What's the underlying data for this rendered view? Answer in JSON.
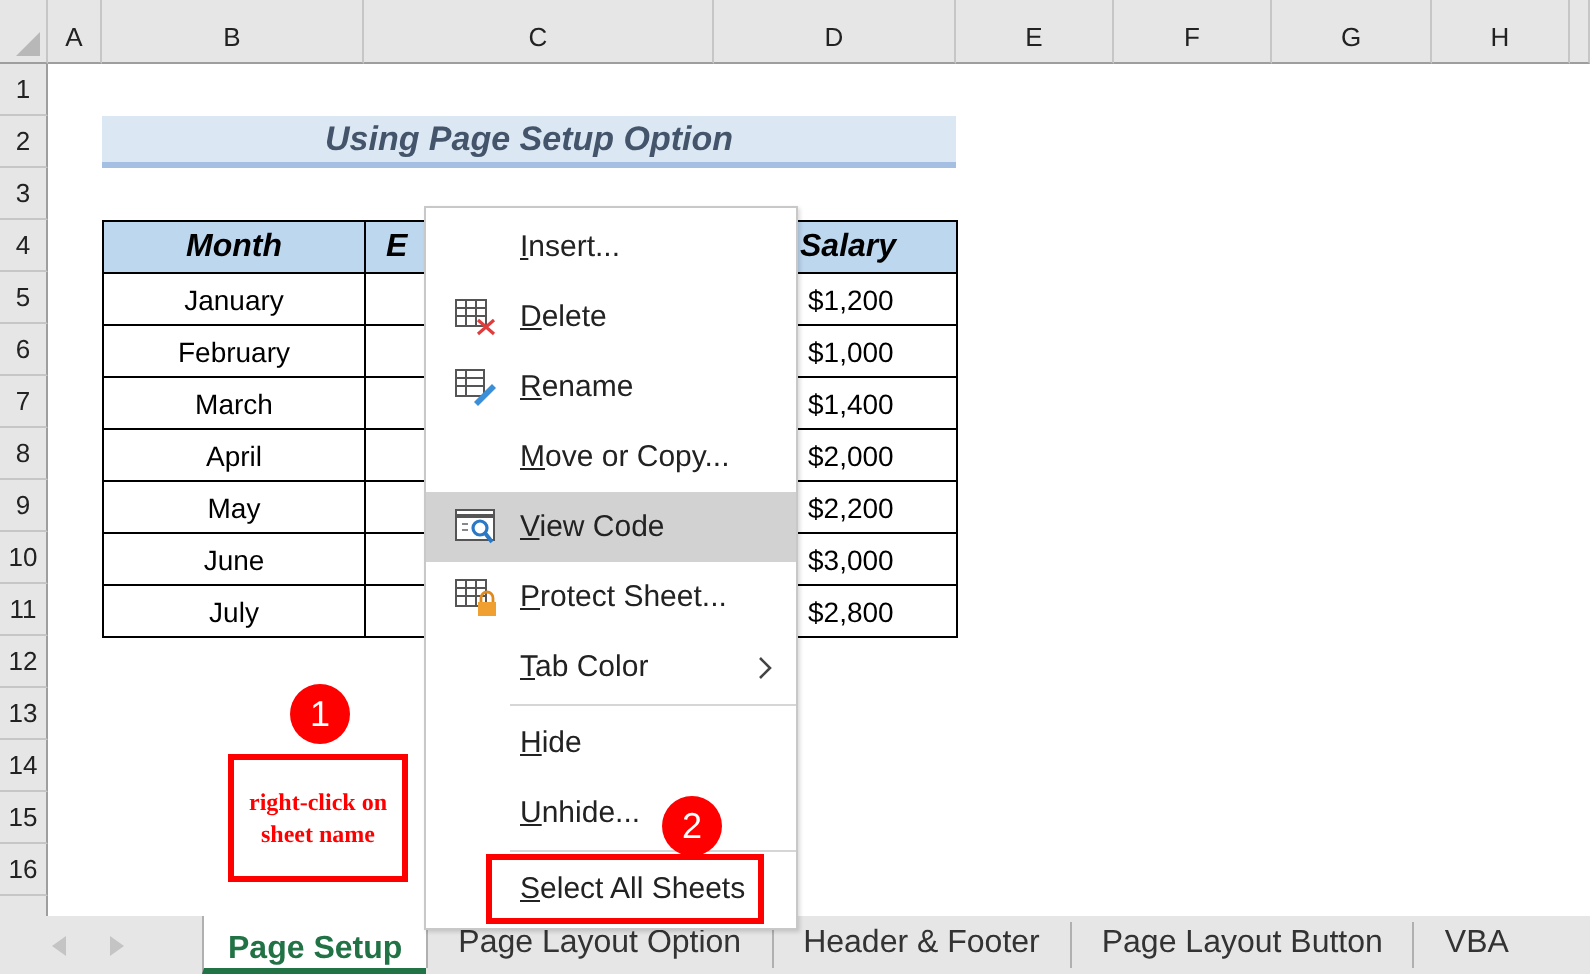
{
  "column_headers": [
    "A",
    "B",
    "C",
    "D",
    "E",
    "F",
    "G",
    "H"
  ],
  "row_headers": [
    "1",
    "2",
    "3",
    "4",
    "5",
    "6",
    "7",
    "8",
    "9",
    "10",
    "11",
    "12",
    "13",
    "14",
    "15",
    "16"
  ],
  "title": "Using Page Setup Option",
  "table": {
    "columns": [
      "Month",
      "E",
      "Salary"
    ],
    "rows": [
      {
        "month": "January",
        "salary": "$1,200"
      },
      {
        "month": "February",
        "salary": "$1,000"
      },
      {
        "month": "March",
        "salary": "$1,400"
      },
      {
        "month": "April",
        "salary": "$2,000"
      },
      {
        "month": "May",
        "salary": "$2,200"
      },
      {
        "month": "June",
        "salary": "$3,000"
      },
      {
        "month": "July",
        "salary": "$2,800"
      }
    ]
  },
  "context_menu": [
    {
      "label": "Insert...",
      "kind": "plain",
      "highlighted": false,
      "separator_before": false,
      "annotated": false
    },
    {
      "label": "Delete",
      "kind": "delete",
      "highlighted": false,
      "separator_before": false,
      "annotated": false
    },
    {
      "label": "Rename",
      "kind": "rename",
      "highlighted": false,
      "separator_before": false,
      "annotated": false
    },
    {
      "label": "Move or Copy...",
      "kind": "plain",
      "highlighted": false,
      "separator_before": false,
      "annotated": false
    },
    {
      "label": "View Code",
      "kind": "code",
      "highlighted": true,
      "separator_before": false,
      "annotated": false
    },
    {
      "label": "Protect Sheet...",
      "kind": "protect",
      "highlighted": false,
      "separator_before": false,
      "annotated": false
    },
    {
      "label": "Tab Color",
      "kind": "submenu",
      "highlighted": false,
      "separator_before": false,
      "annotated": false
    },
    {
      "label": "Hide",
      "kind": "plain",
      "highlighted": false,
      "separator_before": true,
      "annotated": false
    },
    {
      "label": "Unhide...",
      "kind": "plain",
      "highlighted": false,
      "separator_before": false,
      "annotated": false
    },
    {
      "label": "Select All Sheets",
      "kind": "plain",
      "highlighted": false,
      "separator_before": true,
      "annotated": true
    }
  ],
  "annotations": [
    {
      "number": "1",
      "note": "right-click on sheet name"
    },
    {
      "number": "2"
    }
  ],
  "sheet_tabs": [
    {
      "label": "Page Setup",
      "selected": true
    },
    {
      "label": "Page Layout Option",
      "selected": false
    },
    {
      "label": "Header & Footer",
      "selected": false
    },
    {
      "label": "Page Layout Button",
      "selected": false
    },
    {
      "label": "VBA",
      "selected": false
    }
  ]
}
